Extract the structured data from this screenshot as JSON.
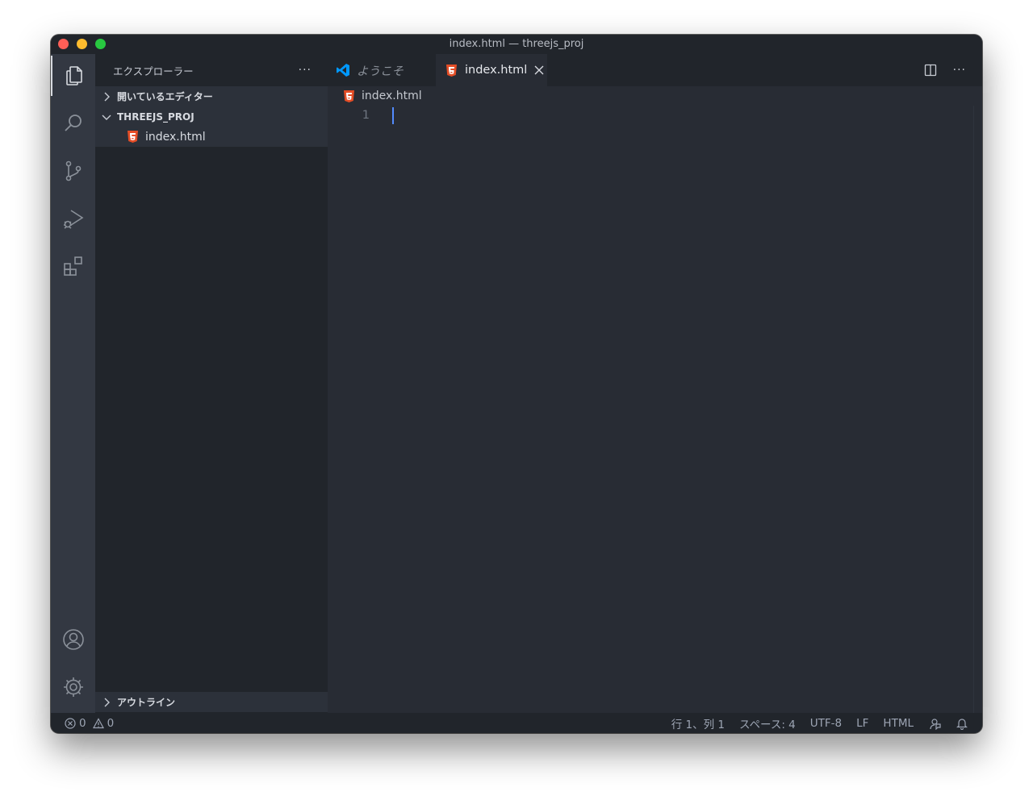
{
  "window": {
    "title": "index.html — threejs_proj"
  },
  "activity_bar": {
    "items": [
      "explorer-icon",
      "search-icon",
      "source-control-icon",
      "run-debug-icon",
      "extensions-icon"
    ],
    "bottom": [
      "account-icon",
      "settings-gear-icon"
    ]
  },
  "sidebar": {
    "title": "エクスプローラー",
    "more": "···",
    "open_editors": "開いているエディター",
    "project": "THREEJS_PROJ",
    "files": [
      "index.html"
    ],
    "outline": "アウトライン"
  },
  "tabs": {
    "welcome": "ようこそ",
    "active": "index.html"
  },
  "editor": {
    "breadcrumb": "index.html",
    "line_number": "1",
    "more": "···"
  },
  "statusbar": {
    "errors": "0",
    "warnings": "0",
    "position": "行 1、列 1",
    "indent": "スペース: 4",
    "encoding": "UTF-8",
    "eol": "LF",
    "language": "HTML"
  },
  "colors": {
    "accent": "#528bff",
    "html_icon": "#e44d26",
    "vscode_blue": "#0098ff"
  }
}
